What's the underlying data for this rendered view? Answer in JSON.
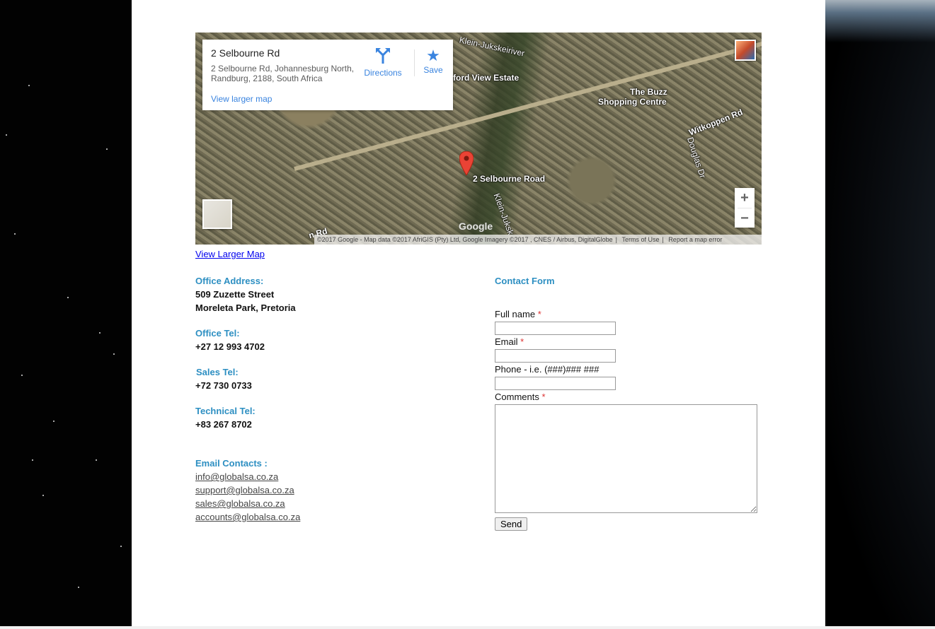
{
  "map": {
    "place_title": "2 Selbourne Rd",
    "place_address": "2 Selbourne Rd, Johannesburg North, Randburg, 2188, South Africa",
    "view_larger_label": "View larger map",
    "directions_label": "Directions",
    "save_label": "Save",
    "marker_label": "2 Selbourne Road",
    "labels": {
      "estate": "ford View Estate",
      "mall_line1": "The Buzz",
      "mall_line2": "Shopping Centre",
      "witkoppen": "Witkoppen Rd",
      "douglas": "Douglas Dr",
      "klein1": "Klein-Jukskeiriver",
      "klein2": "Klein-Juksk",
      "road_bl": "n Rd"
    },
    "zoom_in": "+",
    "zoom_out": "−",
    "google_logo": "Google",
    "attribution": "©2017 Google - Map data ©2017 AfriGIS (Pty) Ltd, Google Imagery ©2017 , CNES / Airbus, DigitalGlobe",
    "terms": "Terms of Use",
    "report": "Report a map error"
  },
  "view_larger_link": "View Larger Map",
  "contact_info": {
    "office_address_heading": "Office Address:",
    "office_address_line1": "509 Zuzette Street",
    "office_address_line2": "Moreleta Park, Pretoria",
    "office_tel_heading": "Office Tel:",
    "office_tel": "+27 12 993 4702",
    "sales_tel_heading": "Sales Tel:",
    "sales_tel": "+72 730 0733",
    "technical_tel_heading": "Technical Tel:",
    "technical_tel": "+83 267 8702",
    "email_heading": "Email Contacts :",
    "emails": [
      "info@globalsa.co.za",
      "support@globalsa.co.za",
      "sales@globalsa.co.za",
      "accounts@globalsa.co.za"
    ]
  },
  "form": {
    "heading": "Contact Form",
    "full_name_label": "Full name",
    "email_label": "Email",
    "phone_label": "Phone - i.e. (###)### ###",
    "comments_label": "Comments",
    "required_marker": "*",
    "full_name_value": "",
    "email_value": "",
    "phone_value": "",
    "comments_value": "",
    "send_label": "Send"
  }
}
